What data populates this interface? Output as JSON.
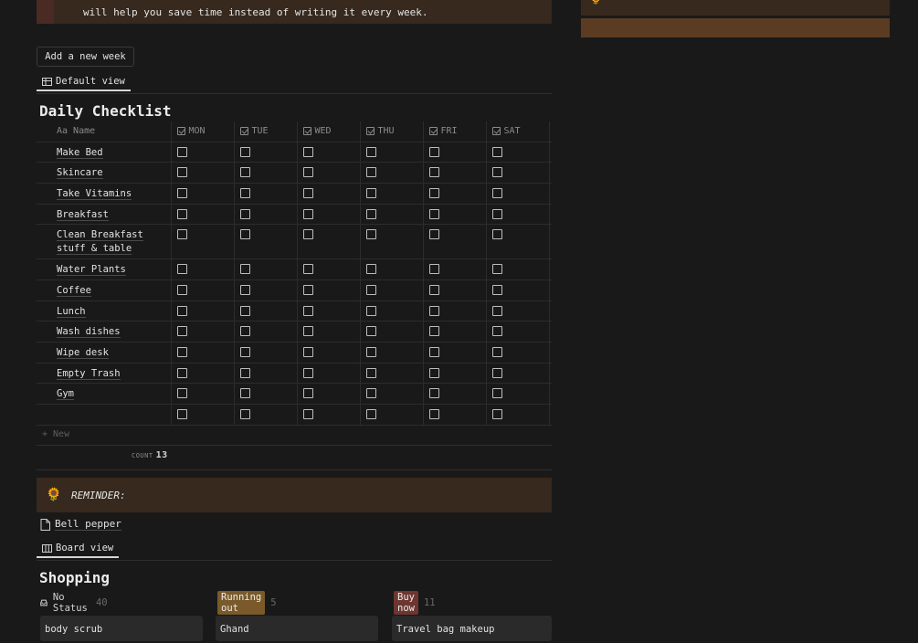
{
  "top_callout": {
    "text": "will help you save time instead of writing it every week."
  },
  "add_button": {
    "label": "Add a new week"
  },
  "default_view": {
    "label": "Default view"
  },
  "checklist": {
    "title": "Daily Checklist",
    "name_header": "Aa Name",
    "days": [
      "MON",
      "TUE",
      "WED",
      "THU",
      "FRI",
      "SAT"
    ],
    "rows": [
      "Make Bed",
      "Skincare",
      "Take Vitamins",
      "Breakfast",
      "Clean Breakfast stuff & table",
      "Water Plants",
      "Coffee",
      "Lunch",
      "Wash dishes",
      "Wipe desk",
      "Empty Trash",
      "Gym",
      ""
    ],
    "new_label": "+ New",
    "count_label": "COUNT",
    "count_value": "13"
  },
  "reminder": {
    "icon": "sunflower-icon",
    "text": "REMINDER:"
  },
  "page_link": {
    "label": "Bell pepper"
  },
  "board_view": {
    "label": "Board view"
  },
  "shopping": {
    "title": "Shopping",
    "columns": [
      {
        "label": "No Status",
        "count": "40",
        "card": "body scrub",
        "color": ""
      },
      {
        "label": "Running out",
        "count": "5",
        "card": "Ghand",
        "color": "#7a5a2a"
      },
      {
        "label": "Buy now",
        "count": "11",
        "card": "Travel bag makeup",
        "color": "#6e3630"
      }
    ]
  },
  "colors": {
    "background": "#191919",
    "callout": "#37291d",
    "accent_brown": "#5b3c22"
  }
}
